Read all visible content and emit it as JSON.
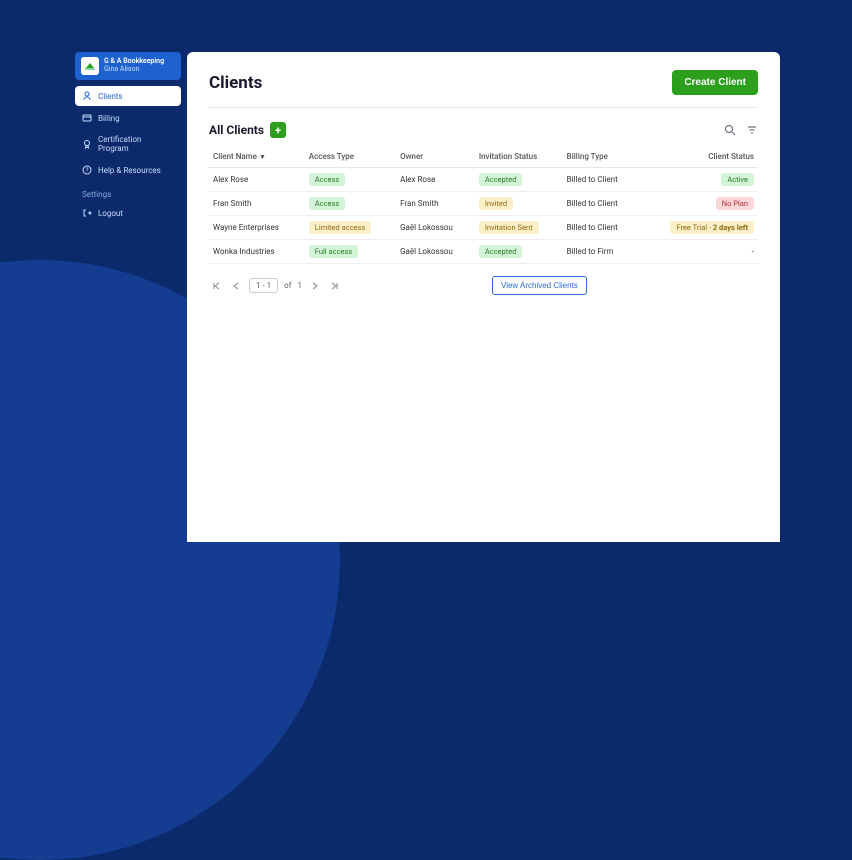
{
  "org": {
    "name": "G & A Bookkeeping",
    "user": "Gina Alison"
  },
  "nav": {
    "items": [
      {
        "label": "Clients",
        "active": true
      },
      {
        "label": "Billing",
        "active": false
      },
      {
        "label": "Certification Program",
        "active": false
      },
      {
        "label": "Help & Resources",
        "active": false
      }
    ],
    "settings_label": "Settings",
    "logout_label": "Logout"
  },
  "page": {
    "title": "Clients",
    "create_label": "Create Client",
    "sub_title": "All Clients",
    "add_symbol": "+",
    "archived_label": "View Archived Clients"
  },
  "table": {
    "headers": [
      "Client Name",
      "Access Type",
      "Owner",
      "Invitation Status",
      "Billing Type",
      "Client Status"
    ],
    "rows": [
      {
        "name": "Alex Rose",
        "access": "Access",
        "access_color": "green",
        "owner": "Alex Rose",
        "invite": "Accepted",
        "invite_color": "green",
        "billing": "Billed to Client",
        "status": "Active",
        "status_color": "green"
      },
      {
        "name": "Fran Smith",
        "access": "Access",
        "access_color": "green",
        "owner": "Fran Smith",
        "invite": "Invited",
        "invite_color": "yellow",
        "billing": "Billed to Client",
        "status": "No Plan",
        "status_color": "red"
      },
      {
        "name": "Wayne Enterprises",
        "access": "Limited access",
        "access_color": "yellow",
        "owner": "Gaël Lokossou",
        "invite": "Invitation Sent",
        "invite_color": "yellow",
        "billing": "Billed to Client",
        "status_prefix": "Free Trial - ",
        "status_bold": "2 days left",
        "status_color": "yellow"
      },
      {
        "name": "Wonka Industries",
        "access": "Full access",
        "access_color": "green",
        "owner": "Gaël Lokossou",
        "invite": "Accepted",
        "invite_color": "green",
        "billing": "Billed to Firm",
        "status": "-",
        "status_color": "none"
      }
    ]
  },
  "pager": {
    "range": "1 - 1",
    "of_label": "of",
    "total": "1"
  }
}
